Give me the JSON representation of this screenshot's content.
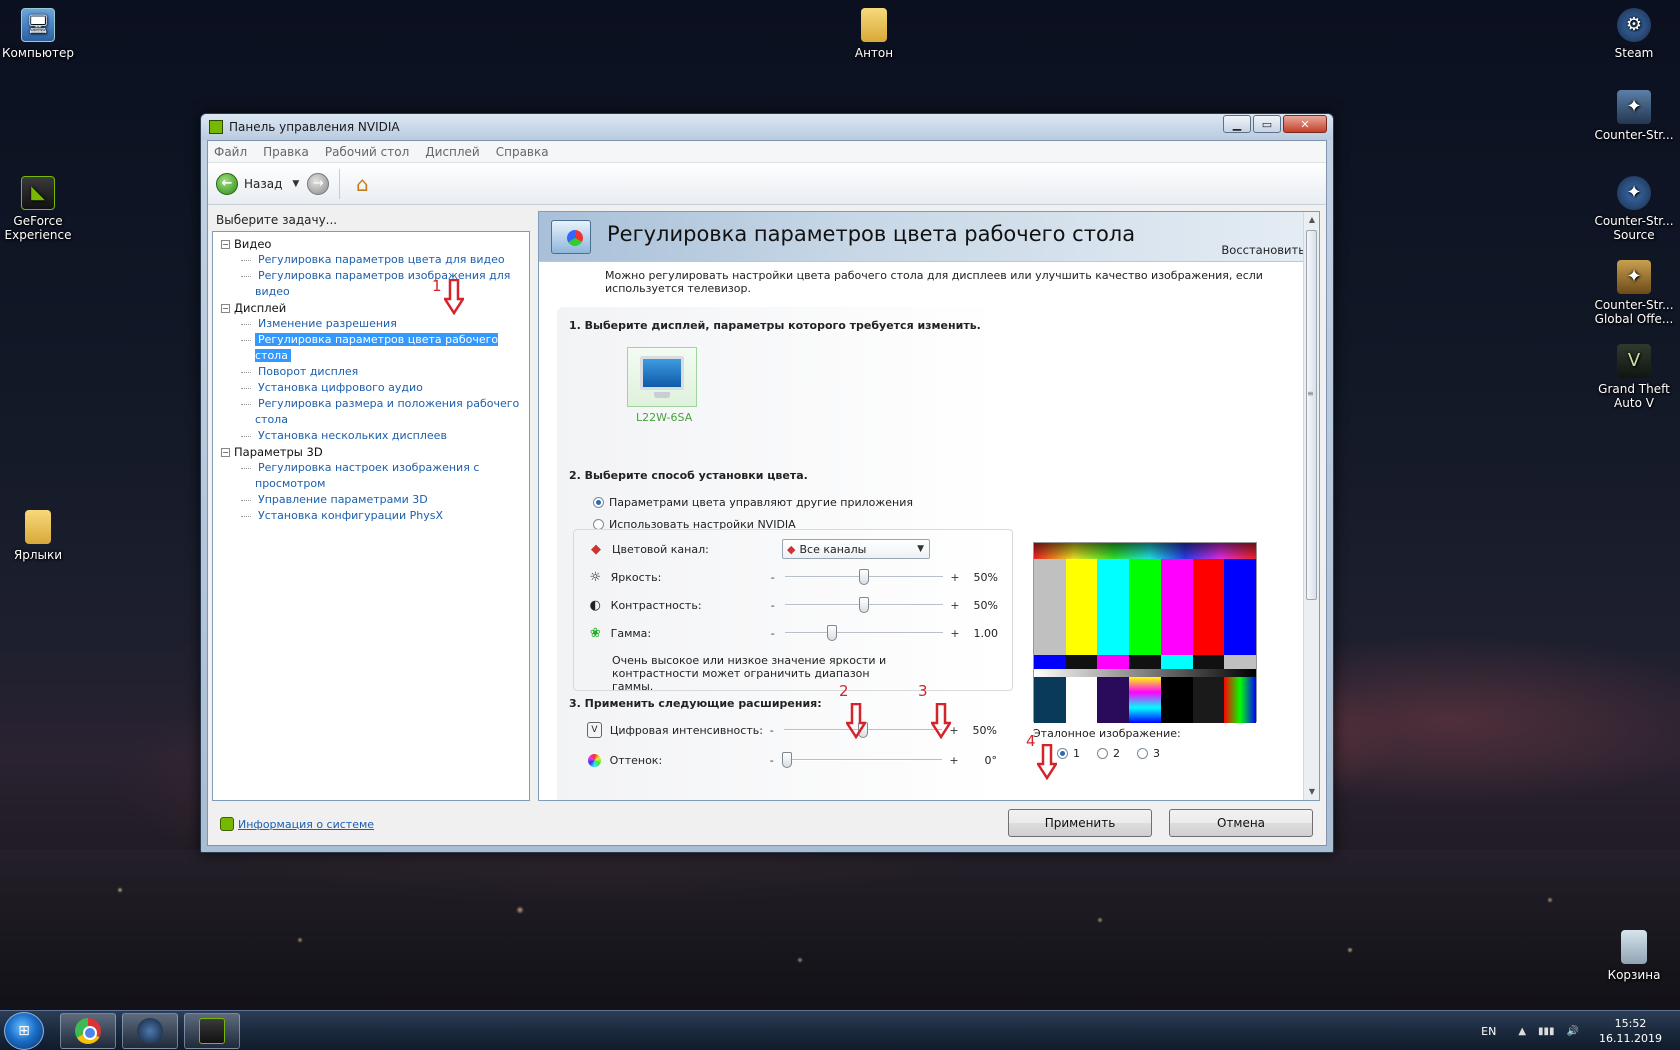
{
  "desktop": {
    "icons": [
      {
        "label": "Компьютер",
        "icon": "computer-icon"
      },
      {
        "label": "Антон",
        "icon": "folder-icon"
      },
      {
        "label": "Steam",
        "icon": "steam-icon"
      },
      {
        "label": "Counter-Str...",
        "icon": "counter-strike-icon"
      },
      {
        "label": "GeForce Experience",
        "icon": "geforce-experience-icon"
      },
      {
        "label": "Counter-Str... Source",
        "icon": "counter-strike-source-icon"
      },
      {
        "label": "Counter-Str... Global Offe...",
        "icon": "csgo-icon"
      },
      {
        "label": "Ярлыки",
        "icon": "folder-icon"
      },
      {
        "label": "Grand Theft Auto V",
        "icon": "gta-icon"
      },
      {
        "label": "Корзина",
        "icon": "recycle-bin-icon"
      }
    ]
  },
  "window": {
    "title": "Панель управления NVIDIA",
    "menu": [
      "Файл",
      "Правка",
      "Рабочий стол",
      "Дисплей",
      "Справка"
    ],
    "toolbar": {
      "back_label": "Назад"
    },
    "task_label": "Выберите задачу...",
    "tree": {
      "video": {
        "label": "Видео",
        "items": [
          "Регулировка параметров цвета для видео",
          "Регулировка параметров изображения для видео"
        ]
      },
      "display": {
        "label": "Дисплей",
        "items": [
          "Изменение разрешения",
          "Регулировка параметров цвета рабочего стола",
          "Поворот дисплея",
          "Установка цифрового аудио",
          "Регулировка размера и положения рабочего стола",
          "Установка нескольких дисплеев"
        ],
        "selected_index": 1
      },
      "params3d": {
        "label": "Параметры 3D",
        "items": [
          "Регулировка настроек изображения с просмотром",
          "Управление параметрами 3D",
          "Установка конфигурации PhysX"
        ]
      }
    },
    "page": {
      "title": "Регулировка параметров цвета рабочего стола",
      "restore": "Восстановить",
      "description": "Можно регулировать настройки цвета рабочего стола для дисплеев или улучшить качество изображения, если используется телевизор.",
      "section1": "1. Выберите дисплей, параметры которого требуется изменить.",
      "display_name": "L22W-6SA",
      "section2": "2. Выберите способ установки цвета.",
      "radio_other_apps": "Параметрами цвета управляют другие приложения",
      "radio_nvidia": "Использовать настройки NVIDIA",
      "color_channel": {
        "label": "Цветовой канал:",
        "value": "Все каналы"
      },
      "brightness": {
        "label": "Яркость:",
        "value": "50%",
        "level": 0.5
      },
      "contrast": {
        "label": "Контрастность:",
        "value": "50%",
        "level": 0.5
      },
      "gamma": {
        "label": "Гамма:",
        "value": "1.00",
        "level": 0.3
      },
      "warning": "Очень высокое или низкое значение яркости и контрастности может ограничить диапазон гаммы.",
      "section3": "3. Применить следующие расширения:",
      "digital_vibrance": {
        "label": "Цифровая интенсивность:",
        "value": "50%",
        "level": 0.5
      },
      "hue": {
        "label": "Оттенок:",
        "value": "0°",
        "level": 0.02
      },
      "reference_image": {
        "label": "Эталонное изображение:",
        "options": [
          "1",
          "2",
          "3"
        ],
        "selected": "1"
      },
      "minus": "-",
      "plus": "+"
    },
    "footer": {
      "sysinfo": "Информация о системе",
      "apply": "Применить",
      "cancel": "Отмена"
    },
    "annotations": [
      "1",
      "2",
      "3",
      "4"
    ]
  },
  "taskbar": {
    "apps": [
      "chrome-icon",
      "steam-icon",
      "nvidia-icon"
    ],
    "lang": "EN",
    "time": "15:52",
    "date": "16.11.2019"
  },
  "colors": {
    "nvidia_green": "#76b900",
    "link_blue": "#1b5fae",
    "selection": "#3399ff",
    "annotation_red": "#d4232a"
  }
}
